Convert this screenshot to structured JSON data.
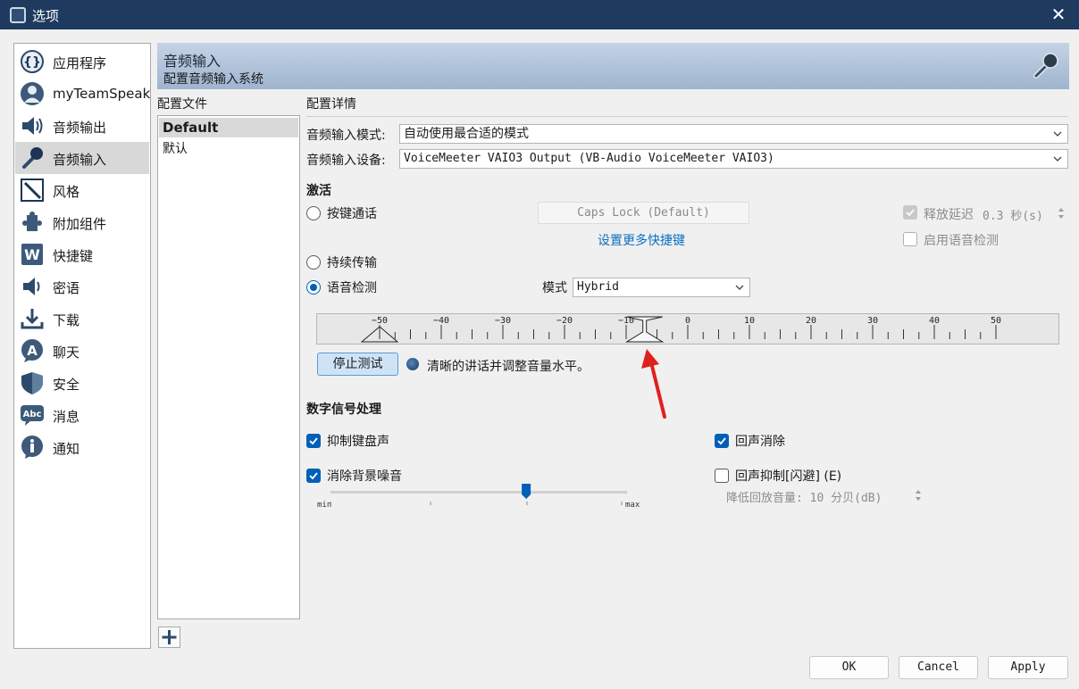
{
  "window": {
    "title": "选项",
    "close_glyph": "✕"
  },
  "sidebar": {
    "items": [
      {
        "label": "应用程序",
        "icon": "application-icon"
      },
      {
        "label": "myTeamSpeak",
        "icon": "user-avatar-icon"
      },
      {
        "label": "音频输出",
        "icon": "speaker-icon"
      },
      {
        "label": "音频输入",
        "icon": "microphone-icon",
        "active": true
      },
      {
        "label": "风格",
        "icon": "design-pencil-icon"
      },
      {
        "label": "附加组件",
        "icon": "puzzle-icon"
      },
      {
        "label": "快捷键",
        "icon": "hotkey-w-icon"
      },
      {
        "label": "密语",
        "icon": "whisper-icon"
      },
      {
        "label": "下载",
        "icon": "download-icon"
      },
      {
        "label": "聊天",
        "icon": "chat-a-icon"
      },
      {
        "label": "安全",
        "icon": "shield-icon"
      },
      {
        "label": "消息",
        "icon": "messages-abc-icon"
      },
      {
        "label": "通知",
        "icon": "info-icon"
      }
    ]
  },
  "banner": {
    "title": "音频输入",
    "subtitle": "配置音频输入系统"
  },
  "profiles": {
    "header_label": "配置文件",
    "selected": "Default",
    "sub_label": "默认"
  },
  "details": {
    "header_label": "配置详情",
    "mode_label": "音频输入模式:",
    "mode_value": "自动使用最合适的模式",
    "device_label": "音频输入设备:",
    "device_value": "VoiceMeeter VAIO3 Output (VB-Audio VoiceMeeter VAIO3)"
  },
  "activation": {
    "section_label": "激活",
    "ptt_label": "按键通话",
    "hotkey_value": "Caps Lock (Default)",
    "more_hotkeys_link": "设置更多快捷键",
    "release_delay_label": "释放延迟",
    "release_delay_value": "0.3 秒(s)",
    "enable_vad_label": "启用语音检测",
    "continuous_label": "持续传输",
    "vad_label": "语音检测",
    "mode_label": "模式",
    "mode_value": "Hybrid"
  },
  "meter": {
    "tick_labels": [
      "−50",
      "−40",
      "−30",
      "−20",
      "−10",
      "0",
      "10",
      "20",
      "30",
      "40",
      "50"
    ],
    "range_db": [
      -50,
      50
    ],
    "threshold_db": -50,
    "level_db": -7
  },
  "test": {
    "stop_label": "停止测试",
    "hint": "清晰的讲话并调整音量水平。"
  },
  "dsp": {
    "section_label": "数字信号处理",
    "typing_label": "抑制键盘声",
    "noise_label": "消除背景噪音",
    "slider_min": "min",
    "slider_max": "max",
    "noise_level": 0.66,
    "echo_cancel_label": "回声消除",
    "echo_reduction_label": "回声抑制[闪避] (E)",
    "reduction_label": "降低回放音量: 10 分贝(dB)"
  },
  "footer": {
    "ok": "OK",
    "cancel": "Cancel",
    "apply": "Apply"
  },
  "colors": {
    "titlebar": "#1e3a5e",
    "accent": "#005fb8",
    "link": "#0a6fc2"
  }
}
